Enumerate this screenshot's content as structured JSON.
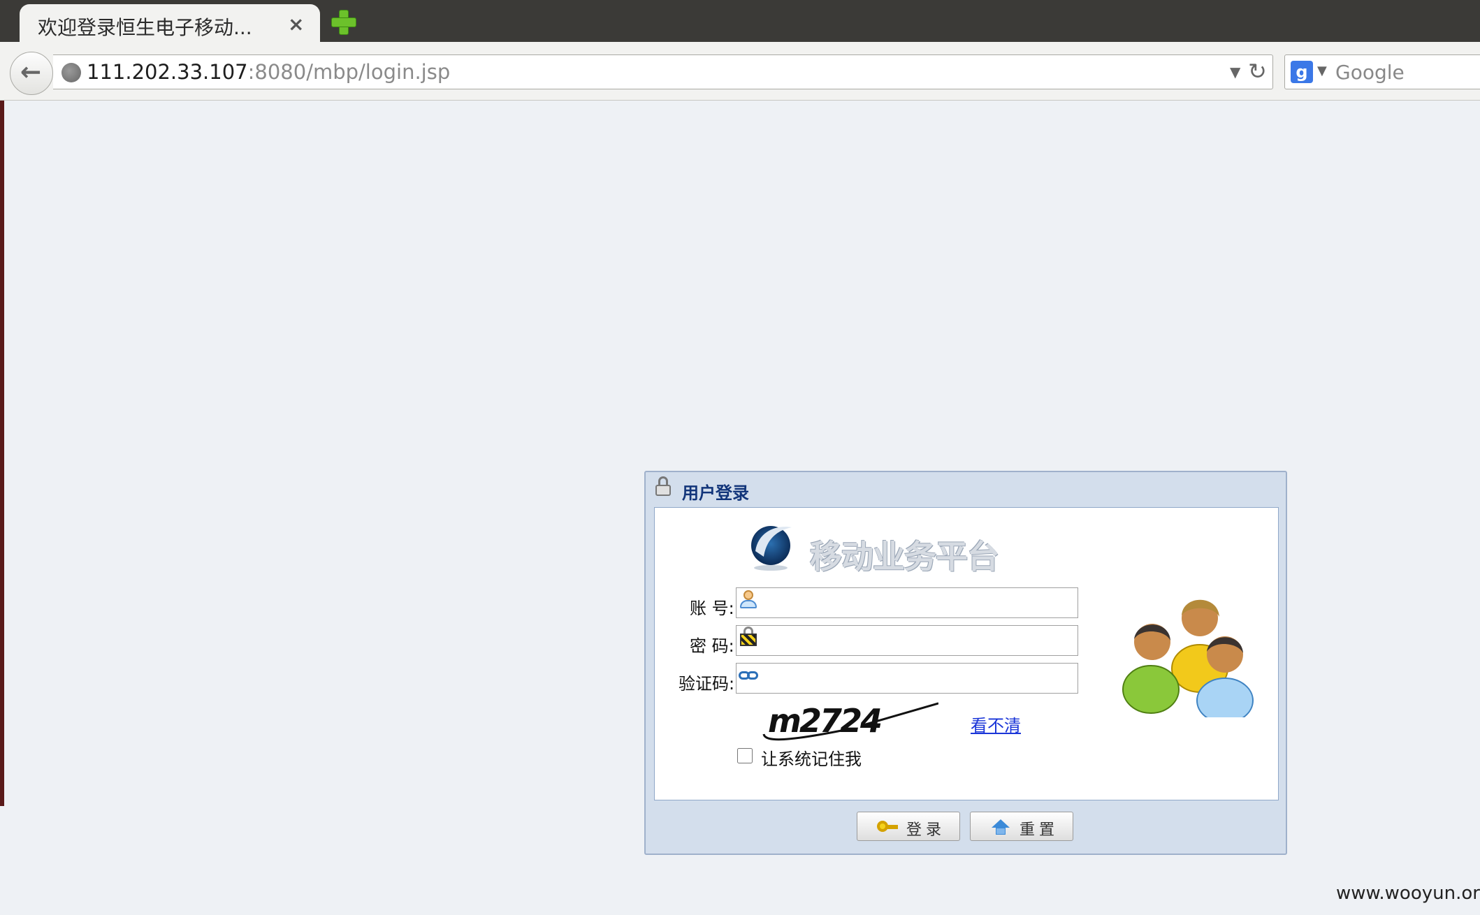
{
  "browser": {
    "tab_title": "欢迎登录恒生电子移动...",
    "tab_close": "×",
    "url_host": "111.202.33.107",
    "url_path": ":8080/mbp/login.jsp",
    "search_engine_label": "g",
    "search_placeholder": "Google"
  },
  "login": {
    "panel_title": "用户登录",
    "brand_name": "移动业务平台",
    "account_label": "账 号:",
    "password_label": "密 码:",
    "captcha_label": "验证码:",
    "account_value": "",
    "password_value": "",
    "captcha_value": "",
    "captcha_text": "m2724",
    "captcha_refresh": "看不清",
    "remember_label": "让系统记住我",
    "remember_checked": false,
    "login_button": "登录",
    "reset_button": "重置"
  },
  "watermark": "www.wooyun.org",
  "colors": {
    "page_bg": "#eef1f5",
    "panel_bg": "#d3deec",
    "title_color": "#12357a",
    "link_color": "#1a35d8"
  }
}
